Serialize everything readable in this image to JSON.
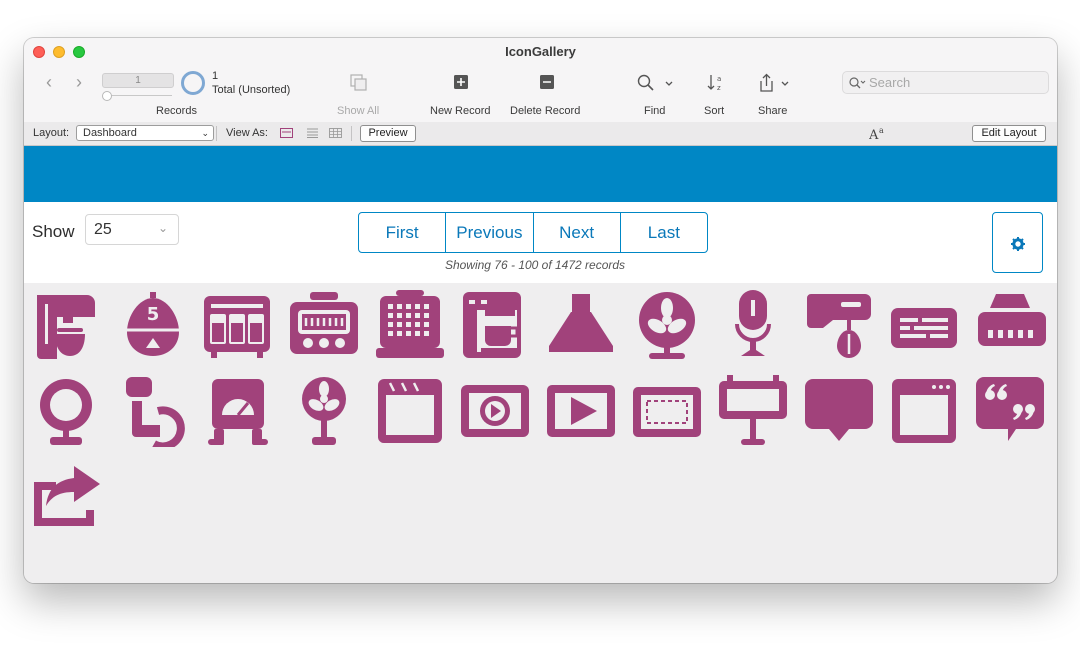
{
  "window": {
    "title": "IconGallery"
  },
  "toolbar": {
    "record_field": "1",
    "record_count": "1",
    "record_total": "Total (Unsorted)",
    "records_label": "Records",
    "show_all_label": "Show All",
    "new_record_label": "New Record",
    "delete_record_label": "Delete Record",
    "find_label": "Find",
    "sort_label": "Sort",
    "share_label": "Share",
    "search_placeholder": "Search"
  },
  "layoutbar": {
    "layout_label": "Layout:",
    "layout_value": "Dashboard",
    "view_as_label": "View As:",
    "preview_label": "Preview",
    "edit_layout_label": "Edit Layout"
  },
  "content": {
    "show_label": "Show",
    "show_value": "25",
    "pager": [
      "First",
      "Previous",
      "Next",
      "Last"
    ],
    "showing_text": "Showing 76 - 100 of 1472 records"
  },
  "colors": {
    "accent": "#0087c5",
    "icon": "#a1427b"
  },
  "icons": [
    "stand-mixer-icon",
    "egg-timer-icon",
    "oven-icon",
    "toaster-oven-icon",
    "waffle-maker-icon",
    "espresso-machine-icon",
    "range-hood-icon",
    "desk-fan-icon",
    "microphone-stand-icon",
    "hand-mixer-icon",
    "radio-panel-icon",
    "range-hood-vent-icon",
    "magnifier-stand-icon",
    "wheelchair-icon",
    "meter-box-icon",
    "pedestal-fan-icon",
    "browser-window-icon",
    "video-play-icon",
    "play-button-icon",
    "dashed-frame-icon",
    "billboard-icon",
    "speech-bubble-icon",
    "app-window-icon",
    "quote-bubble-icon",
    "share-export-icon"
  ]
}
